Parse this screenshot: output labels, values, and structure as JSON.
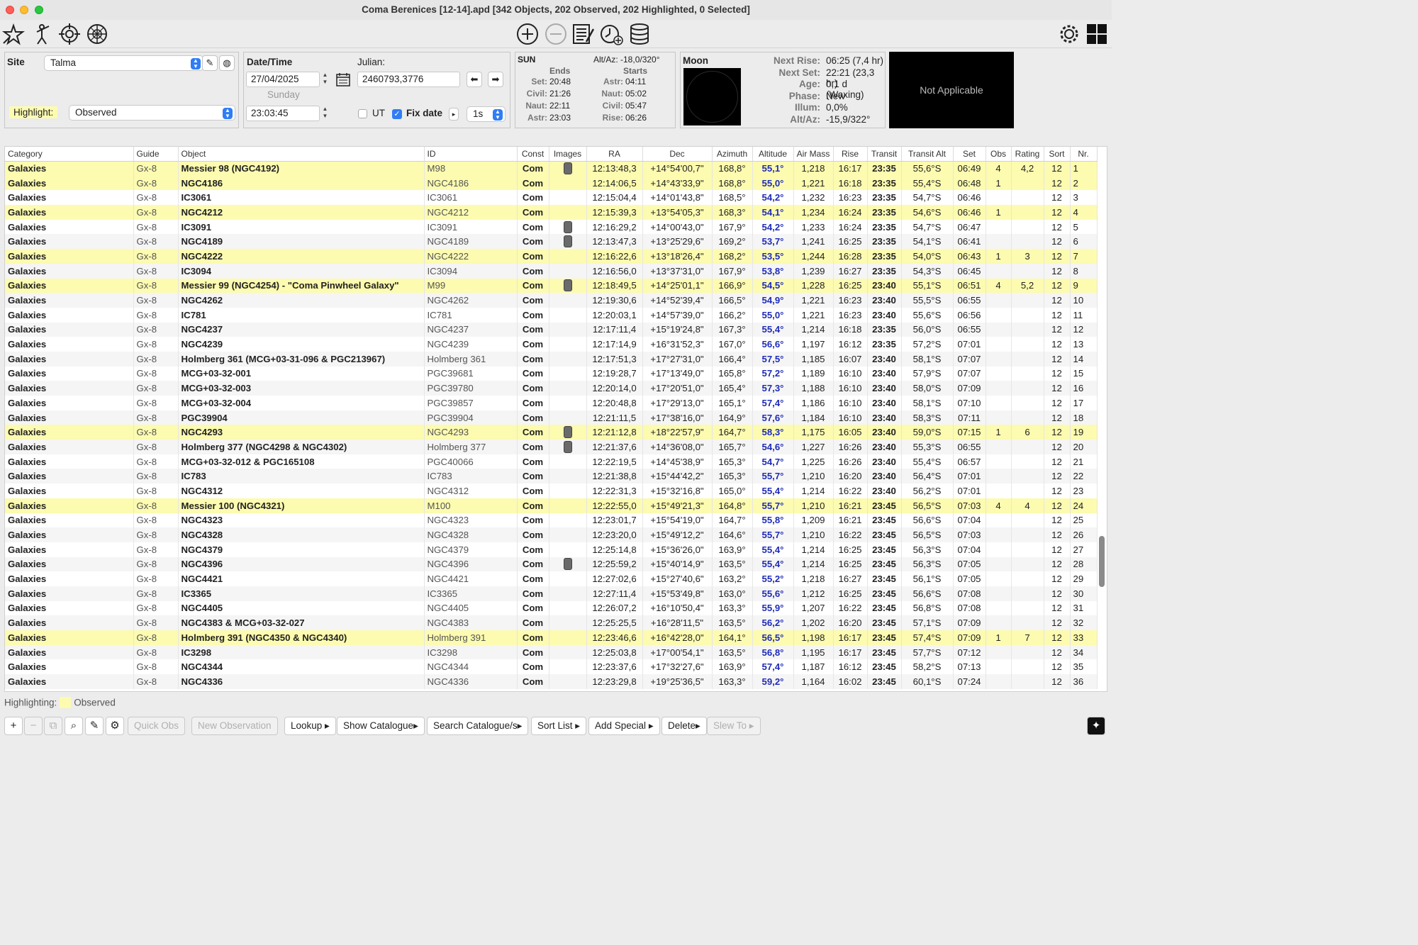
{
  "window": {
    "title": "Coma Berenices [12-14].apd [342 Objects, 202 Observed, 202 Highlighted, 0 Selected]"
  },
  "toolbar": {
    "left_icons": [
      "star-icon",
      "observer-icon",
      "crosshair-icon",
      "compass-icon"
    ],
    "center_icons": [
      "plus-circle-icon",
      "minus-circle-icon",
      "notes-icon",
      "clock-add-icon",
      "database-icon"
    ],
    "right_icons": [
      "gear-icon",
      "windows-icon"
    ]
  },
  "site": {
    "label": "Site",
    "value": "Talma",
    "highlight_label": "Highlight:",
    "highlight_value": "Observed"
  },
  "datetime": {
    "label": "Date/Time",
    "date": "27/04/2025",
    "weekday": "Sunday",
    "time": "23:03:45",
    "julian_label": "Julian:",
    "julian": "2460793,3776",
    "ut_label": "UT",
    "fixdate_label": "Fix date",
    "step": "1s"
  },
  "sun": {
    "label": "SUN",
    "altaz": "Alt/Az: -18,0/320°",
    "ends_label": "Ends",
    "starts_label": "Starts",
    "ends": [
      [
        "Set:",
        "20:48"
      ],
      [
        "Civil:",
        "21:26"
      ],
      [
        "Naut:",
        "22:11"
      ],
      [
        "Astr:",
        "23:03"
      ]
    ],
    "starts": [
      [
        "Astr:",
        "04:11"
      ],
      [
        "Naut:",
        "05:02"
      ],
      [
        "Civil:",
        "05:47"
      ],
      [
        "Rise:",
        "06:26"
      ]
    ]
  },
  "moon": {
    "label": "Moon",
    "info": [
      [
        "Next Rise:",
        "06:25 (7,4 hr)"
      ],
      [
        "Next Set:",
        "22:21 (23,3 hr)"
      ],
      [
        "Age:",
        "0,1 d (Waxing)"
      ],
      [
        "Phase:",
        "New"
      ],
      [
        "Illum:",
        "0,0%"
      ],
      [
        "Alt/Az:",
        "-15,9/322°"
      ]
    ],
    "image_text": "Not Applicable"
  },
  "table": {
    "columns": [
      "Category",
      "Guide",
      "Object",
      "ID",
      "Const",
      "Images",
      "RA",
      "Dec",
      "Azimuth",
      "Altitude",
      "Air Mass",
      "Rise",
      "Transit",
      "Transit Alt",
      "Set",
      "Obs",
      "Rating",
      "Sort",
      "Nr."
    ],
    "rows": [
      {
        "hl": true,
        "img": true,
        "c": [
          "Galaxies",
          "Gx-8",
          "Messier 98 (NGC4192)",
          "M98",
          "Com",
          "",
          "12:13:48,3",
          "+14°54'00,7\"",
          "168,8°",
          "55,1°",
          "1,218",
          "16:17",
          "23:35",
          "55,6°S",
          "06:49",
          "4",
          "4,2",
          "12",
          "1"
        ]
      },
      {
        "hl": true,
        "img": false,
        "c": [
          "Galaxies",
          "Gx-8",
          "NGC4186",
          "NGC4186",
          "Com",
          "",
          "12:14:06,5",
          "+14°43'33,9\"",
          "168,8°",
          "55,0°",
          "1,221",
          "16:18",
          "23:35",
          "55,4°S",
          "06:48",
          "1",
          "",
          "12",
          "2"
        ]
      },
      {
        "hl": false,
        "img": false,
        "c": [
          "Galaxies",
          "Gx-8",
          "IC3061",
          "IC3061",
          "Com",
          "",
          "12:15:04,4",
          "+14°01'43,8\"",
          "168,5°",
          "54,2°",
          "1,232",
          "16:23",
          "23:35",
          "54,7°S",
          "06:46",
          "",
          "",
          "12",
          "3"
        ]
      },
      {
        "hl": true,
        "img": false,
        "c": [
          "Galaxies",
          "Gx-8",
          "NGC4212",
          "NGC4212",
          "Com",
          "",
          "12:15:39,3",
          "+13°54'05,3\"",
          "168,3°",
          "54,1°",
          "1,234",
          "16:24",
          "23:35",
          "54,6°S",
          "06:46",
          "1",
          "",
          "12",
          "4"
        ]
      },
      {
        "hl": false,
        "img": true,
        "c": [
          "Galaxies",
          "Gx-8",
          "IC3091",
          "IC3091",
          "Com",
          "",
          "12:16:29,2",
          "+14°00'43,0\"",
          "167,9°",
          "54,2°",
          "1,233",
          "16:24",
          "23:35",
          "54,7°S",
          "06:47",
          "",
          "",
          "12",
          "5"
        ]
      },
      {
        "hl": false,
        "img": true,
        "c": [
          "Galaxies",
          "Gx-8",
          "NGC4189",
          "NGC4189",
          "Com",
          "",
          "12:13:47,3",
          "+13°25'29,6\"",
          "169,2°",
          "53,7°",
          "1,241",
          "16:25",
          "23:35",
          "54,1°S",
          "06:41",
          "",
          "",
          "12",
          "6"
        ]
      },
      {
        "hl": true,
        "img": false,
        "c": [
          "Galaxies",
          "Gx-8",
          "NGC4222",
          "NGC4222",
          "Com",
          "",
          "12:16:22,6",
          "+13°18'26,4\"",
          "168,2°",
          "53,5°",
          "1,244",
          "16:28",
          "23:35",
          "54,0°S",
          "06:43",
          "1",
          "3",
          "12",
          "7"
        ]
      },
      {
        "hl": false,
        "img": false,
        "c": [
          "Galaxies",
          "Gx-8",
          "IC3094",
          "IC3094",
          "Com",
          "",
          "12:16:56,0",
          "+13°37'31,0\"",
          "167,9°",
          "53,8°",
          "1,239",
          "16:27",
          "23:35",
          "54,3°S",
          "06:45",
          "",
          "",
          "12",
          "8"
        ]
      },
      {
        "hl": true,
        "img": true,
        "c": [
          "Galaxies",
          "Gx-8",
          "Messier 99 (NGC4254) - \"Coma Pinwheel Galaxy\"",
          "M99",
          "Com",
          "",
          "12:18:49,5",
          "+14°25'01,1\"",
          "166,9°",
          "54,5°",
          "1,228",
          "16:25",
          "23:40",
          "55,1°S",
          "06:51",
          "4",
          "5,2",
          "12",
          "9"
        ]
      },
      {
        "hl": false,
        "img": false,
        "c": [
          "Galaxies",
          "Gx-8",
          "NGC4262",
          "NGC4262",
          "Com",
          "",
          "12:19:30,6",
          "+14°52'39,4\"",
          "166,5°",
          "54,9°",
          "1,221",
          "16:23",
          "23:40",
          "55,5°S",
          "06:55",
          "",
          "",
          "12",
          "10"
        ]
      },
      {
        "hl": false,
        "img": false,
        "c": [
          "Galaxies",
          "Gx-8",
          "IC781",
          "IC781",
          "Com",
          "",
          "12:20:03,1",
          "+14°57'39,0\"",
          "166,2°",
          "55,0°",
          "1,221",
          "16:23",
          "23:40",
          "55,6°S",
          "06:56",
          "",
          "",
          "12",
          "11"
        ]
      },
      {
        "hl": false,
        "img": false,
        "c": [
          "Galaxies",
          "Gx-8",
          "NGC4237",
          "NGC4237",
          "Com",
          "",
          "12:17:11,4",
          "+15°19'24,8\"",
          "167,3°",
          "55,4°",
          "1,214",
          "16:18",
          "23:35",
          "56,0°S",
          "06:55",
          "",
          "",
          "12",
          "12"
        ]
      },
      {
        "hl": false,
        "img": false,
        "c": [
          "Galaxies",
          "Gx-8",
          "NGC4239",
          "NGC4239",
          "Com",
          "",
          "12:17:14,9",
          "+16°31'52,3\"",
          "167,0°",
          "56,6°",
          "1,197",
          "16:12",
          "23:35",
          "57,2°S",
          "07:01",
          "",
          "",
          "12",
          "13"
        ]
      },
      {
        "hl": false,
        "img": false,
        "c": [
          "Galaxies",
          "Gx-8",
          "Holmberg 361 (MCG+03-31-096 & PGC213967)",
          "Holmberg 361",
          "Com",
          "",
          "12:17:51,3",
          "+17°27'31,0\"",
          "166,4°",
          "57,5°",
          "1,185",
          "16:07",
          "23:40",
          "58,1°S",
          "07:07",
          "",
          "",
          "12",
          "14"
        ]
      },
      {
        "hl": false,
        "img": false,
        "c": [
          "Galaxies",
          "Gx-8",
          "MCG+03-32-001",
          "PGC39681",
          "Com",
          "",
          "12:19:28,7",
          "+17°13'49,0\"",
          "165,8°",
          "57,2°",
          "1,189",
          "16:10",
          "23:40",
          "57,9°S",
          "07:07",
          "",
          "",
          "12",
          "15"
        ]
      },
      {
        "hl": false,
        "img": false,
        "c": [
          "Galaxies",
          "Gx-8",
          "MCG+03-32-003",
          "PGC39780",
          "Com",
          "",
          "12:20:14,0",
          "+17°20'51,0\"",
          "165,4°",
          "57,3°",
          "1,188",
          "16:10",
          "23:40",
          "58,0°S",
          "07:09",
          "",
          "",
          "12",
          "16"
        ]
      },
      {
        "hl": false,
        "img": false,
        "c": [
          "Galaxies",
          "Gx-8",
          "MCG+03-32-004",
          "PGC39857",
          "Com",
          "",
          "12:20:48,8",
          "+17°29'13,0\"",
          "165,1°",
          "57,4°",
          "1,186",
          "16:10",
          "23:40",
          "58,1°S",
          "07:10",
          "",
          "",
          "12",
          "17"
        ]
      },
      {
        "hl": false,
        "img": false,
        "c": [
          "Galaxies",
          "Gx-8",
          "PGC39904",
          "PGC39904",
          "Com",
          "",
          "12:21:11,5",
          "+17°38'16,0\"",
          "164,9°",
          "57,6°",
          "1,184",
          "16:10",
          "23:40",
          "58,3°S",
          "07:11",
          "",
          "",
          "12",
          "18"
        ]
      },
      {
        "hl": true,
        "img": true,
        "c": [
          "Galaxies",
          "Gx-8",
          "NGC4293",
          "NGC4293",
          "Com",
          "",
          "12:21:12,8",
          "+18°22'57,9\"",
          "164,7°",
          "58,3°",
          "1,175",
          "16:05",
          "23:40",
          "59,0°S",
          "07:15",
          "1",
          "6",
          "12",
          "19"
        ]
      },
      {
        "hl": false,
        "img": true,
        "c": [
          "Galaxies",
          "Gx-8",
          "Holmberg 377 (NGC4298 & NGC4302)",
          "Holmberg 377",
          "Com",
          "",
          "12:21:37,6",
          "+14°36'08,0\"",
          "165,7°",
          "54,6°",
          "1,227",
          "16:26",
          "23:40",
          "55,3°S",
          "06:55",
          "",
          "",
          "12",
          "20"
        ]
      },
      {
        "hl": false,
        "img": false,
        "c": [
          "Galaxies",
          "Gx-8",
          "MCG+03-32-012 & PGC165108",
          "PGC40066",
          "Com",
          "",
          "12:22:19,5",
          "+14°45'38,9\"",
          "165,3°",
          "54,7°",
          "1,225",
          "16:26",
          "23:40",
          "55,4°S",
          "06:57",
          "",
          "",
          "12",
          "21"
        ]
      },
      {
        "hl": false,
        "img": false,
        "c": [
          "Galaxies",
          "Gx-8",
          "IC783",
          "IC783",
          "Com",
          "",
          "12:21:38,8",
          "+15°44'42,2\"",
          "165,3°",
          "55,7°",
          "1,210",
          "16:20",
          "23:40",
          "56,4°S",
          "07:01",
          "",
          "",
          "12",
          "22"
        ]
      },
      {
        "hl": false,
        "img": false,
        "c": [
          "Galaxies",
          "Gx-8",
          "NGC4312",
          "NGC4312",
          "Com",
          "",
          "12:22:31,3",
          "+15°32'16,8\"",
          "165,0°",
          "55,4°",
          "1,214",
          "16:22",
          "23:40",
          "56,2°S",
          "07:01",
          "",
          "",
          "12",
          "23"
        ]
      },
      {
        "hl": true,
        "img": false,
        "c": [
          "Galaxies",
          "Gx-8",
          "Messier 100 (NGC4321)",
          "M100",
          "Com",
          "",
          "12:22:55,0",
          "+15°49'21,3\"",
          "164,8°",
          "55,7°",
          "1,210",
          "16:21",
          "23:45",
          "56,5°S",
          "07:03",
          "4",
          "4",
          "12",
          "24"
        ]
      },
      {
        "hl": false,
        "img": false,
        "c": [
          "Galaxies",
          "Gx-8",
          "NGC4323",
          "NGC4323",
          "Com",
          "",
          "12:23:01,7",
          "+15°54'19,0\"",
          "164,7°",
          "55,8°",
          "1,209",
          "16:21",
          "23:45",
          "56,6°S",
          "07:04",
          "",
          "",
          "12",
          "25"
        ]
      },
      {
        "hl": false,
        "img": false,
        "c": [
          "Galaxies",
          "Gx-8",
          "NGC4328",
          "NGC4328",
          "Com",
          "",
          "12:23:20,0",
          "+15°49'12,2\"",
          "164,6°",
          "55,7°",
          "1,210",
          "16:22",
          "23:45",
          "56,5°S",
          "07:03",
          "",
          "",
          "12",
          "26"
        ]
      },
      {
        "hl": false,
        "img": false,
        "c": [
          "Galaxies",
          "Gx-8",
          "NGC4379",
          "NGC4379",
          "Com",
          "",
          "12:25:14,8",
          "+15°36'26,0\"",
          "163,9°",
          "55,4°",
          "1,214",
          "16:25",
          "23:45",
          "56,3°S",
          "07:04",
          "",
          "",
          "12",
          "27"
        ]
      },
      {
        "hl": false,
        "img": true,
        "c": [
          "Galaxies",
          "Gx-8",
          "NGC4396",
          "NGC4396",
          "Com",
          "",
          "12:25:59,2",
          "+15°40'14,9\"",
          "163,5°",
          "55,4°",
          "1,214",
          "16:25",
          "23:45",
          "56,3°S",
          "07:05",
          "",
          "",
          "12",
          "28"
        ]
      },
      {
        "hl": false,
        "img": false,
        "c": [
          "Galaxies",
          "Gx-8",
          "NGC4421",
          "NGC4421",
          "Com",
          "",
          "12:27:02,6",
          "+15°27'40,6\"",
          "163,2°",
          "55,2°",
          "1,218",
          "16:27",
          "23:45",
          "56,1°S",
          "07:05",
          "",
          "",
          "12",
          "29"
        ]
      },
      {
        "hl": false,
        "img": false,
        "c": [
          "Galaxies",
          "Gx-8",
          "IC3365",
          "IC3365",
          "Com",
          "",
          "12:27:11,4",
          "+15°53'49,8\"",
          "163,0°",
          "55,6°",
          "1,212",
          "16:25",
          "23:45",
          "56,6°S",
          "07:08",
          "",
          "",
          "12",
          "30"
        ]
      },
      {
        "hl": false,
        "img": false,
        "c": [
          "Galaxies",
          "Gx-8",
          "NGC4405",
          "NGC4405",
          "Com",
          "",
          "12:26:07,2",
          "+16°10'50,4\"",
          "163,3°",
          "55,9°",
          "1,207",
          "16:22",
          "23:45",
          "56,8°S",
          "07:08",
          "",
          "",
          "12",
          "31"
        ]
      },
      {
        "hl": false,
        "img": false,
        "c": [
          "Galaxies",
          "Gx-8",
          "NGC4383 & MCG+03-32-027",
          "NGC4383",
          "Com",
          "",
          "12:25:25,5",
          "+16°28'11,5\"",
          "163,5°",
          "56,2°",
          "1,202",
          "16:20",
          "23:45",
          "57,1°S",
          "07:09",
          "",
          "",
          "12",
          "32"
        ]
      },
      {
        "hl": true,
        "img": false,
        "c": [
          "Galaxies",
          "Gx-8",
          "Holmberg 391 (NGC4350 & NGC4340)",
          "Holmberg 391",
          "Com",
          "",
          "12:23:46,6",
          "+16°42'28,0\"",
          "164,1°",
          "56,5°",
          "1,198",
          "16:17",
          "23:45",
          "57,4°S",
          "07:09",
          "1",
          "7",
          "12",
          "33"
        ]
      },
      {
        "hl": false,
        "img": false,
        "c": [
          "Galaxies",
          "Gx-8",
          "IC3298",
          "IC3298",
          "Com",
          "",
          "12:25:03,8",
          "+17°00'54,1\"",
          "163,5°",
          "56,8°",
          "1,195",
          "16:17",
          "23:45",
          "57,7°S",
          "07:12",
          "",
          "",
          "12",
          "34"
        ]
      },
      {
        "hl": false,
        "img": false,
        "c": [
          "Galaxies",
          "Gx-8",
          "NGC4344",
          "NGC4344",
          "Com",
          "",
          "12:23:37,6",
          "+17°32'27,6\"",
          "163,9°",
          "57,4°",
          "1,187",
          "16:12",
          "23:45",
          "58,2°S",
          "07:13",
          "",
          "",
          "12",
          "35"
        ]
      },
      {
        "hl": false,
        "img": false,
        "c": [
          "Galaxies",
          "Gx-8",
          "NGC4336",
          "NGC4336",
          "Com",
          "",
          "12:23:29,8",
          "+19°25'36,5\"",
          "163,3°",
          "59,2°",
          "1,164",
          "16:02",
          "23:45",
          "60,1°S",
          "07:24",
          "",
          "",
          "12",
          "36"
        ]
      }
    ]
  },
  "footer": {
    "highlighting_label": "Highlighting:",
    "highlighting_value": "Observed",
    "buttons": [
      "Quick Obs",
      "New Observation",
      "Lookup",
      "Show Catalogue",
      "Search Catalogue/s",
      "Sort List",
      "Add Special",
      "Delete",
      "Slew To"
    ]
  },
  "colors": {
    "highlight": "#fcfbb0",
    "altitude": "#1f2bb8",
    "accent": "#2f7df6"
  }
}
